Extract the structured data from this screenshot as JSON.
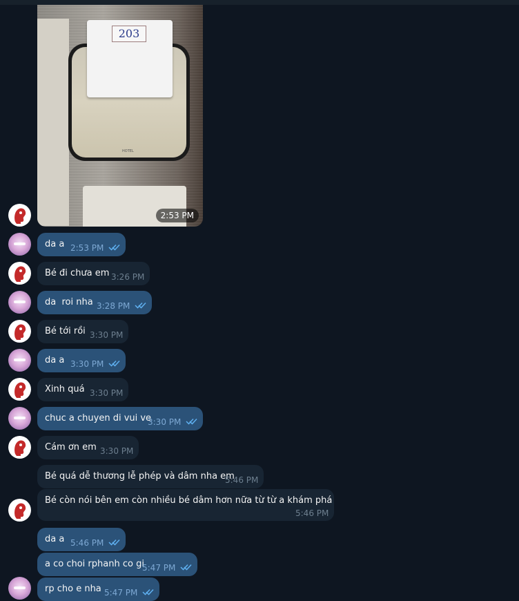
{
  "photo": {
    "room_number": "203",
    "brand_mark": "HOTEL",
    "time": "2:53 PM"
  },
  "messages": [
    {
      "text": "da a",
      "time": "2:53 PM",
      "dir": "out"
    },
    {
      "text": "Bé đi chưa em",
      "time": "3:26 PM",
      "dir": "in"
    },
    {
      "text": "da  roi nha",
      "time": "3:28 PM",
      "dir": "out"
    },
    {
      "text": "Bé tới rồi",
      "time": "3:30 PM",
      "dir": "in"
    },
    {
      "text": "da a",
      "time": "3:30 PM",
      "dir": "out"
    },
    {
      "text": "Xinh quá",
      "time": "3:30 PM",
      "dir": "in"
    },
    {
      "text": "chuc a chuyen di vui ve",
      "time": "3:30 PM",
      "dir": "out"
    },
    {
      "text": "Cám ơn em",
      "time": "3:30 PM",
      "dir": "in"
    },
    {
      "text": "Bé quá dễ thương lễ phép và dâm nha em",
      "time": "5:46 PM",
      "dir": "in"
    },
    {
      "text": "Bé còn nói bên em còn nhiều bé dâm hơn nữa từ từ a khám phá",
      "time": "5:46 PM",
      "dir": "in"
    },
    {
      "text": "da a",
      "time": "5:46 PM",
      "dir": "out"
    },
    {
      "text": "a co choi rphanh co gi",
      "time": "5:47 PM",
      "dir": "out"
    },
    {
      "text": "rp cho e nha",
      "time": "5:47 PM",
      "dir": "out"
    }
  ],
  "icons": {
    "read_receipt": "double-check-icon",
    "contact_avatar": "red-head-avatar",
    "own_avatar": "pink-avatar"
  },
  "colors": {
    "background": "#0e1621",
    "bubble_out": "#2b5278",
    "bubble_in": "#182533",
    "tick": "#5fb0f0"
  }
}
